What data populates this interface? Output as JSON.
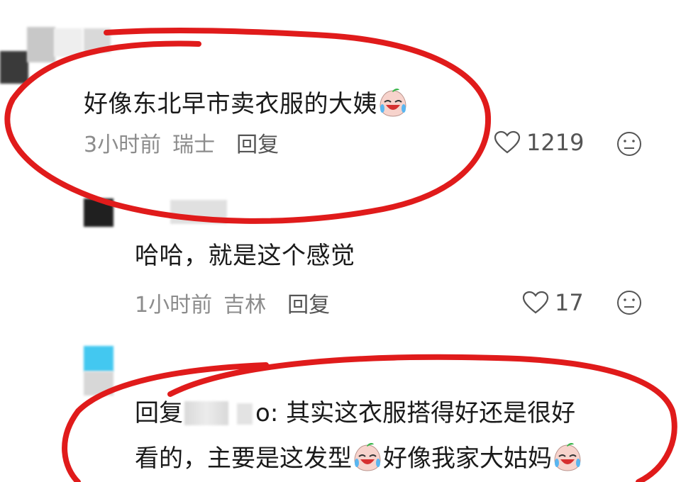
{
  "comments": [
    {
      "text": "好像东北早市卖衣服的大姨",
      "time": "3小时前",
      "location": "瑞士",
      "reply_label": "回复",
      "likes": "1219",
      "emoji": "crying-laughing-peach-emoji"
    },
    {
      "text": "哈哈，就是这个感觉",
      "time": "1小时前",
      "location": "吉林",
      "reply_label": "回复",
      "likes": "17"
    }
  ],
  "reply_comment": {
    "prefix": "回复",
    "partial_name": "o",
    "line1_rest": ":  其实这衣服搭得好还是很好",
    "line2_a": "看的，主要是这发型",
    "line2_b": "好像我家大姑妈"
  },
  "icons": {
    "like": "heart-outline-icon",
    "dislike": "neutral-face-icon",
    "emoji": "crying-laughing-peach-emoji"
  },
  "colors": {
    "marker": "#e01b1b",
    "meta_gray": "#8c8c8c",
    "text": "#1a1a1a"
  }
}
